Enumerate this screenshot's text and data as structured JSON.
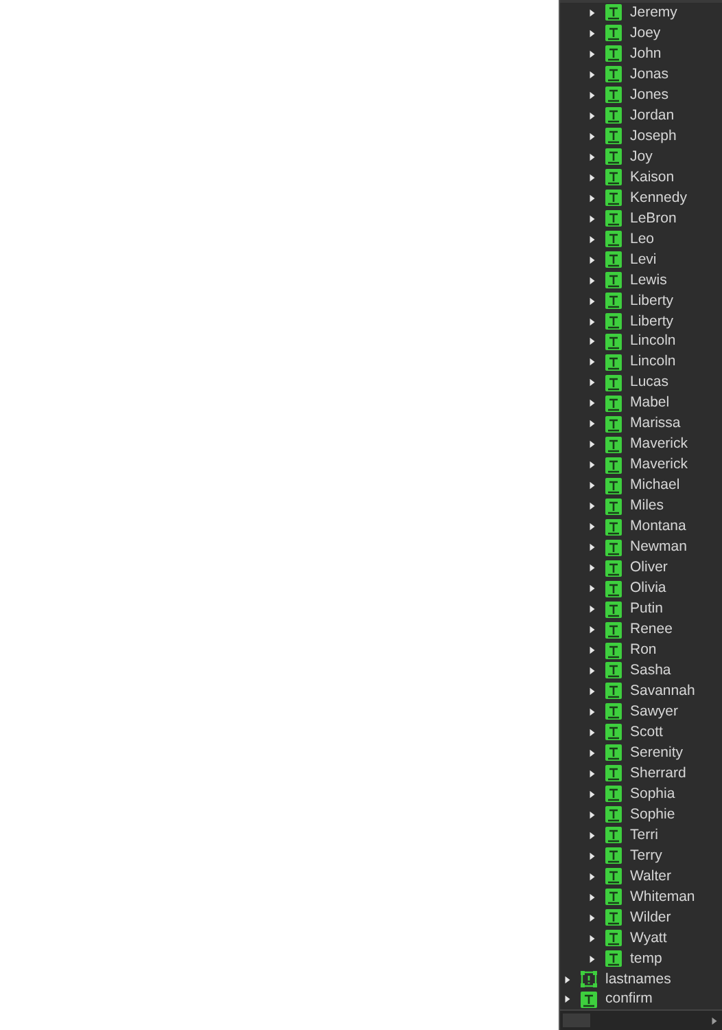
{
  "tree": [
    {
      "children": [
        {
          "label": "Jeremy",
          "kind": "text",
          "expanded": false
        },
        {
          "label": "Joey",
          "kind": "text",
          "expanded": false
        },
        {
          "label": "John",
          "kind": "text",
          "expanded": false
        },
        {
          "label": "Jonas",
          "kind": "text",
          "expanded": false
        },
        {
          "label": "Jones",
          "kind": "text",
          "expanded": false
        },
        {
          "label": "Jordan",
          "kind": "text",
          "expanded": false
        },
        {
          "label": "Joseph",
          "kind": "text",
          "expanded": false
        },
        {
          "label": "Joy",
          "kind": "text",
          "expanded": false
        },
        {
          "label": "Kaison",
          "kind": "text",
          "expanded": false
        },
        {
          "label": "Kennedy",
          "kind": "text",
          "expanded": false
        },
        {
          "label": "LeBron",
          "kind": "text",
          "expanded": false
        },
        {
          "label": "Leo",
          "kind": "text",
          "expanded": false
        },
        {
          "label": "Levi",
          "kind": "text",
          "expanded": false
        },
        {
          "label": "Lewis",
          "kind": "text",
          "expanded": false
        },
        {
          "label": "Liberty",
          "kind": "text",
          "expanded": false
        },
        {
          "label": "Liberty",
          "kind": "text",
          "expanded": false
        },
        {
          "label": "Lincoln",
          "kind": "text",
          "expanded": false
        },
        {
          "label": "Lincoln",
          "kind": "text",
          "expanded": false
        },
        {
          "label": "Lucas",
          "kind": "text",
          "expanded": false
        },
        {
          "label": "Mabel",
          "kind": "text",
          "expanded": false
        },
        {
          "label": "Marissa",
          "kind": "text",
          "expanded": false
        },
        {
          "label": "Maverick",
          "kind": "text",
          "expanded": false
        },
        {
          "label": "Maverick",
          "kind": "text",
          "expanded": false
        },
        {
          "label": "Michael",
          "kind": "text",
          "expanded": false
        },
        {
          "label": "Miles",
          "kind": "text",
          "expanded": false
        },
        {
          "label": "Montana",
          "kind": "text",
          "expanded": false
        },
        {
          "label": "Newman",
          "kind": "text",
          "expanded": false
        },
        {
          "label": "Oliver",
          "kind": "text",
          "expanded": false
        },
        {
          "label": "Olivia",
          "kind": "text",
          "expanded": false
        },
        {
          "label": "Putin",
          "kind": "text",
          "expanded": false
        },
        {
          "label": "Renee",
          "kind": "text",
          "expanded": false
        },
        {
          "label": "Ron",
          "kind": "text",
          "expanded": false
        },
        {
          "label": "Sasha",
          "kind": "text",
          "expanded": false
        },
        {
          "label": "Savannah",
          "kind": "text",
          "expanded": false
        },
        {
          "label": "Sawyer",
          "kind": "text",
          "expanded": false
        },
        {
          "label": "Scott",
          "kind": "text",
          "expanded": false
        },
        {
          "label": "Serenity",
          "kind": "text",
          "expanded": false
        },
        {
          "label": "Sherrard",
          "kind": "text",
          "expanded": false
        },
        {
          "label": "Sophia",
          "kind": "text",
          "expanded": false
        },
        {
          "label": "Sophie",
          "kind": "text",
          "expanded": false
        },
        {
          "label": "Terri",
          "kind": "text",
          "expanded": false
        },
        {
          "label": "Terry",
          "kind": "text",
          "expanded": false
        },
        {
          "label": "Walter",
          "kind": "text",
          "expanded": false
        },
        {
          "label": "Whiteman",
          "kind": "text",
          "expanded": false
        },
        {
          "label": "Wilder",
          "kind": "text",
          "expanded": false
        },
        {
          "label": "Wyatt",
          "kind": "text",
          "expanded": false
        },
        {
          "label": "temp",
          "kind": "text",
          "expanded": false
        }
      ]
    },
    {
      "label": "lastnames",
      "kind": "group",
      "expanded": false
    },
    {
      "label": "confirm",
      "kind": "text",
      "expanded": false
    }
  ]
}
